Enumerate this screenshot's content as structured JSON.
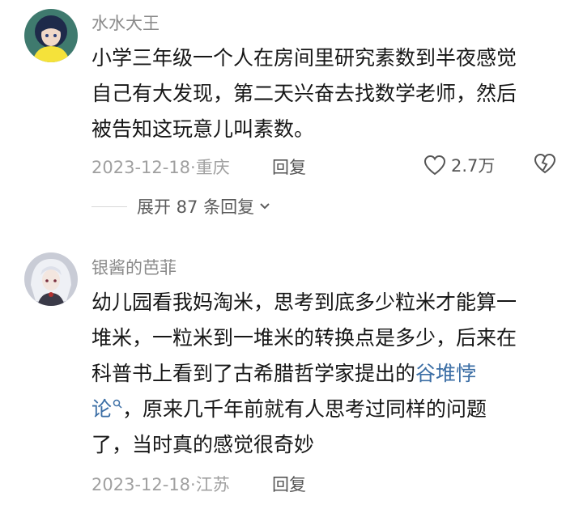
{
  "comments": [
    {
      "username": "水水大王",
      "lines": [
        "小学三年级一个人在房间里研究素数到半夜感觉",
        "自己有大发现，第二天兴奋去找数学老师，然后",
        "被告知这玩意儿叫素数。"
      ],
      "date": "2023-12-18",
      "separator": "·",
      "location": "重庆",
      "reply_label": "回复",
      "likes": "2.7万",
      "expand_label": "展开 87 条回复",
      "colors": {
        "avatar_bg": "#3f7a6e",
        "avatar_hair": "#1e2a4a",
        "avatar_coat": "#f5e23a"
      }
    },
    {
      "username": "银酱的芭菲",
      "lines": [
        "幼儿园看我妈淘米，思考到底多少粒米才能算一",
        "堆米，一粒米到一堆米的转换点是多少，后来在"
      ],
      "line3_prefix": "科普书上看到了古希腊哲学家提出的",
      "link_part1": "谷堆悖",
      "link_part2": "论",
      "line4_suffix": "，原来几千年前就有人思考过同样的问题",
      "line5": "了，当时真的感觉很奇妙",
      "date": "2023-12-18",
      "separator": "·",
      "location": "江苏",
      "reply_label": "回复",
      "colors": {
        "avatar_bg": "#c9ccd6",
        "avatar_hair": "#eef0f5",
        "avatar_face": "#f3e6df"
      }
    }
  ],
  "icons": {
    "like": "heart-outline-icon",
    "dislike": "broken-heart-icon",
    "expand": "chevron-down-icon",
    "link_search": "search-icon"
  }
}
